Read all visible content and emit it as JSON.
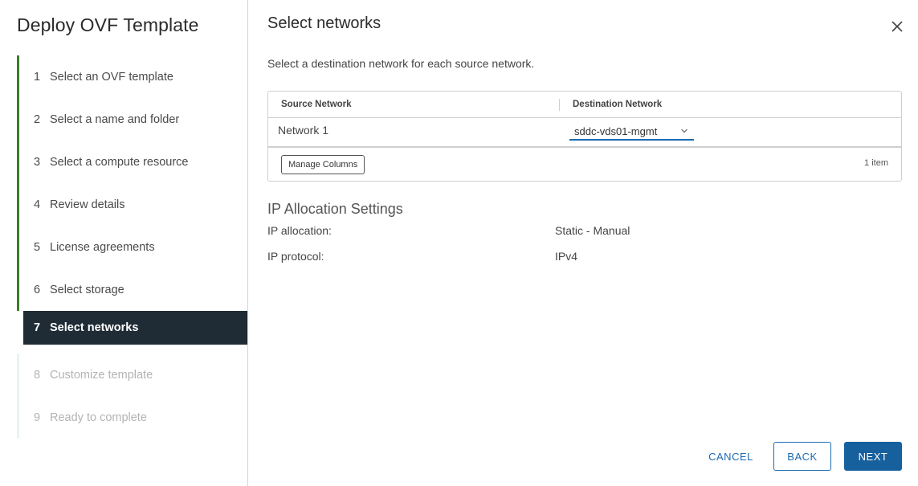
{
  "wizard": {
    "title": "Deploy OVF Template",
    "steps": [
      {
        "num": "1",
        "label": "Select an OVF template",
        "state": "done"
      },
      {
        "num": "2",
        "label": "Select a name and folder",
        "state": "done"
      },
      {
        "num": "3",
        "label": "Select a compute resource",
        "state": "done"
      },
      {
        "num": "4",
        "label": "Review details",
        "state": "done"
      },
      {
        "num": "5",
        "label": "License agreements",
        "state": "done"
      },
      {
        "num": "6",
        "label": "Select storage",
        "state": "done"
      },
      {
        "num": "7",
        "label": "Select networks",
        "state": "active"
      },
      {
        "num": "8",
        "label": "Customize template",
        "state": "future"
      },
      {
        "num": "9",
        "label": "Ready to complete",
        "state": "future"
      }
    ]
  },
  "page": {
    "title": "Select networks",
    "subtitle": "Select a destination network for each source network."
  },
  "grid": {
    "columns": [
      "Source Network",
      "Destination Network"
    ],
    "rows": [
      {
        "source": "Network 1",
        "destination": "sddc-vds01-mgmt"
      }
    ],
    "manage_columns_label": "Manage Columns",
    "item_count": "1 item"
  },
  "ip_settings": {
    "title": "IP Allocation Settings",
    "allocation_label": "IP allocation:",
    "allocation_value": "Static - Manual",
    "protocol_label": "IP protocol:",
    "protocol_value": "IPv4"
  },
  "footer": {
    "cancel_label": "CANCEL",
    "back_label": "BACK",
    "next_label": "NEXT"
  },
  "icons": {
    "close": "close-icon",
    "dropdown": "chevron-down-icon"
  },
  "colors": {
    "completed_bar": "#3c7d28",
    "active_step_bg": "#1f2c35",
    "primary": "#17609e",
    "link": "#1b6bb0"
  }
}
